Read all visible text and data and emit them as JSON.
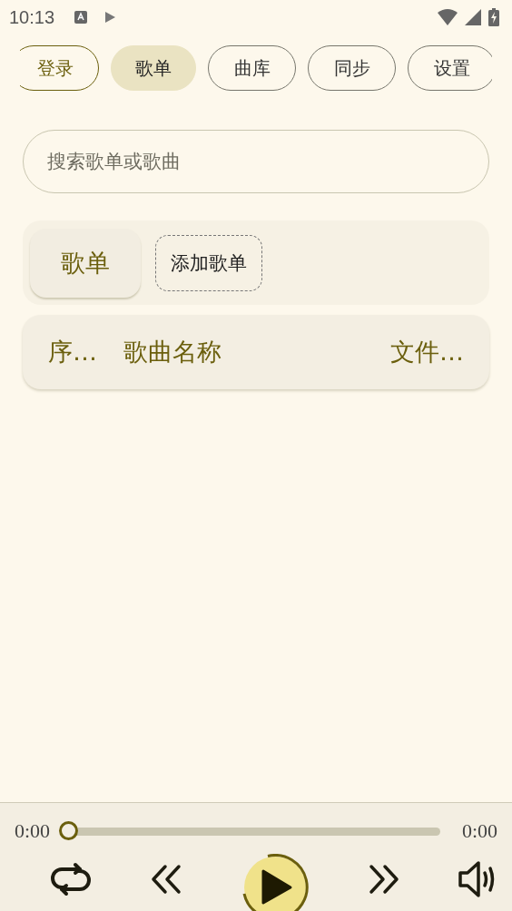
{
  "status_bar": {
    "time": "10:13"
  },
  "tabs": [
    {
      "label": "登录",
      "kind": "accent",
      "selected": false
    },
    {
      "label": "歌单",
      "kind": "plain",
      "selected": true
    },
    {
      "label": "曲库",
      "kind": "plain",
      "selected": false
    },
    {
      "label": "同步",
      "kind": "plain",
      "selected": false
    },
    {
      "label": "设置",
      "kind": "plain",
      "selected": false
    }
  ],
  "search": {
    "placeholder": "搜索歌单或歌曲"
  },
  "playlists": [
    {
      "label": "歌单",
      "kind": "playlist"
    },
    {
      "label": "添加歌单",
      "kind": "add"
    }
  ],
  "table": {
    "columns": [
      "序…",
      "歌曲名称",
      "文件…"
    ]
  },
  "player": {
    "elapsed": "0:00",
    "duration": "0:00",
    "progress": {
      "level": 0
    }
  }
}
